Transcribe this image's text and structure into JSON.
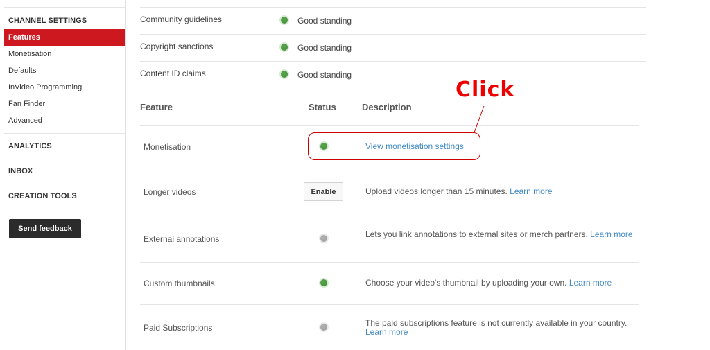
{
  "sidebar": {
    "section_channel_settings": "CHANNEL SETTINGS",
    "items": [
      {
        "label": "Features",
        "active": true
      },
      {
        "label": "Monetisation"
      },
      {
        "label": "Defaults"
      },
      {
        "label": "InVideo Programming"
      },
      {
        "label": "Fan Finder"
      },
      {
        "label": "Advanced"
      }
    ],
    "analytics": "ANALYTICS",
    "inbox": "INBOX",
    "creation_tools": "CREATION TOOLS",
    "send_feedback": "Send feedback"
  },
  "standing": [
    {
      "label": "Community guidelines",
      "status": "Good standing",
      "color": "green"
    },
    {
      "label": "Copyright sanctions",
      "status": "Good standing",
      "color": "green"
    },
    {
      "label": "Content ID claims",
      "status": "Good standing",
      "color": "green"
    }
  ],
  "features_table": {
    "headers": {
      "feature": "Feature",
      "status": "Status",
      "description": "Description"
    },
    "rows": [
      {
        "name": "Monetisation",
        "status": "green",
        "link": "View monetisation settings"
      },
      {
        "name": "Longer videos",
        "status": "button",
        "button_label": "Enable",
        "description": "Upload videos longer than 15 minutes. ",
        "link": "Learn more"
      },
      {
        "name": "External annotations",
        "status": "grey",
        "description": "Lets you link annotations to external sites or merch partners. ",
        "link": "Learn more"
      },
      {
        "name": "Custom thumbnails",
        "status": "green",
        "description": "Choose your video's thumbnail by uploading your own. ",
        "link": "Learn more"
      },
      {
        "name": "Paid Subscriptions",
        "status": "grey",
        "description": "The paid subscriptions feature is not currently available in your country. ",
        "link": "Learn more"
      }
    ]
  },
  "annotation": {
    "text": "Click",
    "color": "#e00000"
  },
  "colors": {
    "accent": "#cc181e",
    "link": "#438bc5",
    "status_green": "#4a9a3f",
    "status_grey": "#a6a6a6"
  }
}
